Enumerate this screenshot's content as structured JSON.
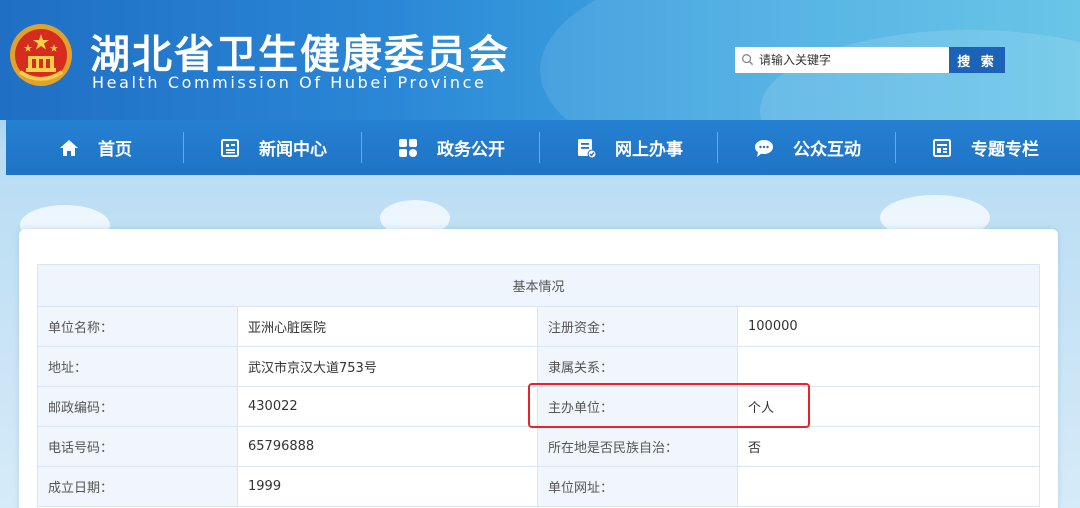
{
  "header": {
    "title": "湖北省卫生健康委员会",
    "subtitle": "Health Commission Of Hubei Province",
    "emblem_icon": "national-emblem-icon"
  },
  "search": {
    "placeholder": "请输入关键字",
    "button_label": "搜 索"
  },
  "nav": {
    "items": [
      {
        "label": "首页",
        "icon": "home-icon"
      },
      {
        "label": "新闻中心",
        "icon": "news-icon"
      },
      {
        "label": "政务公开",
        "icon": "grid-icon"
      },
      {
        "label": "网上办事",
        "icon": "form-check-icon"
      },
      {
        "label": "公众互动",
        "icon": "chat-icon"
      },
      {
        "label": "专题专栏",
        "icon": "column-icon"
      }
    ]
  },
  "info": {
    "heading": "基本情况",
    "rows": [
      {
        "l1": "单位名称：",
        "v1": "亚洲心脏医院",
        "l2": "注册资金：",
        "v2": "100000"
      },
      {
        "l1": "地址：",
        "v1": "武汉市京汉大道753号",
        "l2": "隶属关系：",
        "v2": ""
      },
      {
        "l1": "邮政编码：",
        "v1": "430022",
        "l2": "主办单位：",
        "v2": "个人"
      },
      {
        "l1": "电话号码：",
        "v1": "65796888",
        "l2": "所在地是否民族自治：",
        "v2": "否"
      },
      {
        "l1": "成立日期：",
        "v1": "1999",
        "l2": "单位网址：",
        "v2": ""
      }
    ]
  },
  "colors": {
    "header_blue": "#2a86d6",
    "nav_blue": "#1f73c4",
    "search_button": "#1c63b8",
    "highlight_red": "#e8232a"
  }
}
